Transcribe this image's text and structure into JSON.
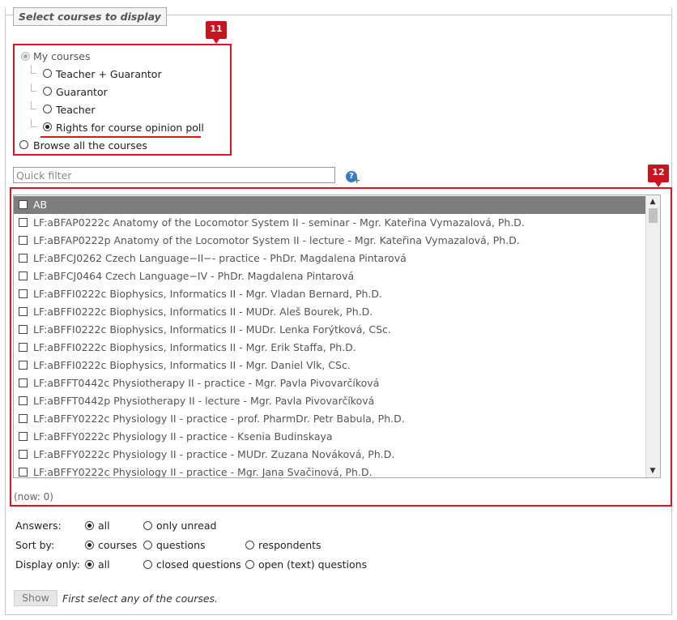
{
  "legend": "Select courses to display",
  "badges": {
    "a": "11",
    "b": "12"
  },
  "course_selection": {
    "my_courses": "My courses",
    "teacher_guarantor": "Teacher + Guarantor",
    "guarantor": "Guarantor",
    "teacher": "Teacher",
    "rights": "Rights for course opinion poll",
    "browse_all": "Browse all the courses"
  },
  "filter": {
    "placeholder": "Quick filter",
    "help_icon": "help-add-icon"
  },
  "list": {
    "header": "AB",
    "rows": [
      "LF:aBFAP0222c Anatomy of the Locomotor System II - seminar - Mgr. Kateřina Vymazalová, Ph.D.",
      "LF:aBFAP0222p Anatomy of the Locomotor System II - lecture - Mgr. Kateřina Vymazalová, Ph.D.",
      "LF:aBFCJ0262 Czech Language−II−- practice - PhDr. Magdalena Pintarová",
      "LF:aBFCJ0464 Czech Language−IV - PhDr. Magdalena Pintarová",
      "LF:aBFFI0222c Biophysics, Informatics II - Mgr. Vladan Bernard, Ph.D.",
      "LF:aBFFI0222c Biophysics, Informatics II - MUDr. Aleš Bourek, Ph.D.",
      "LF:aBFFI0222c Biophysics, Informatics II - MUDr. Lenka Forýtková, CSc.",
      "LF:aBFFI0222c Biophysics, Informatics II - Mgr. Erik Staffa, Ph.D.",
      "LF:aBFFI0222c Biophysics, Informatics II - Mgr. Daniel Vlk, CSc.",
      "LF:aBFFT0442c Physiotherapy II - practice - Mgr. Pavla Pivovarčíková",
      "LF:aBFFT0442p Physiotherapy II - lecture - Mgr. Pavla Pivovarčíková",
      "LF:aBFFY0222c Physiology II - practice - prof. PharmDr. Petr Babula, Ph.D.",
      "LF:aBFFY0222c Physiology II - practice - Ksenia Budinskaya",
      "LF:aBFFY0222c Physiology II - practice - MUDr. Zuzana Nováková, Ph.D.",
      "LF:aBFFY0222c Physiology II - practice - Mgr. Jana Svačinová, Ph.D."
    ],
    "count": "(now: 0)"
  },
  "options": {
    "answers_label": "Answers:",
    "answers_all": "all",
    "answers_unread": "only unread",
    "sort_label": "Sort by:",
    "sort_courses": "courses",
    "sort_questions": "questions",
    "sort_respondents": "respondents",
    "display_label": "Display only:",
    "display_all": "all",
    "display_closed": "closed questions",
    "display_open": "open (text) questions"
  },
  "show_button": "Show",
  "hint": "First select any of the courses."
}
